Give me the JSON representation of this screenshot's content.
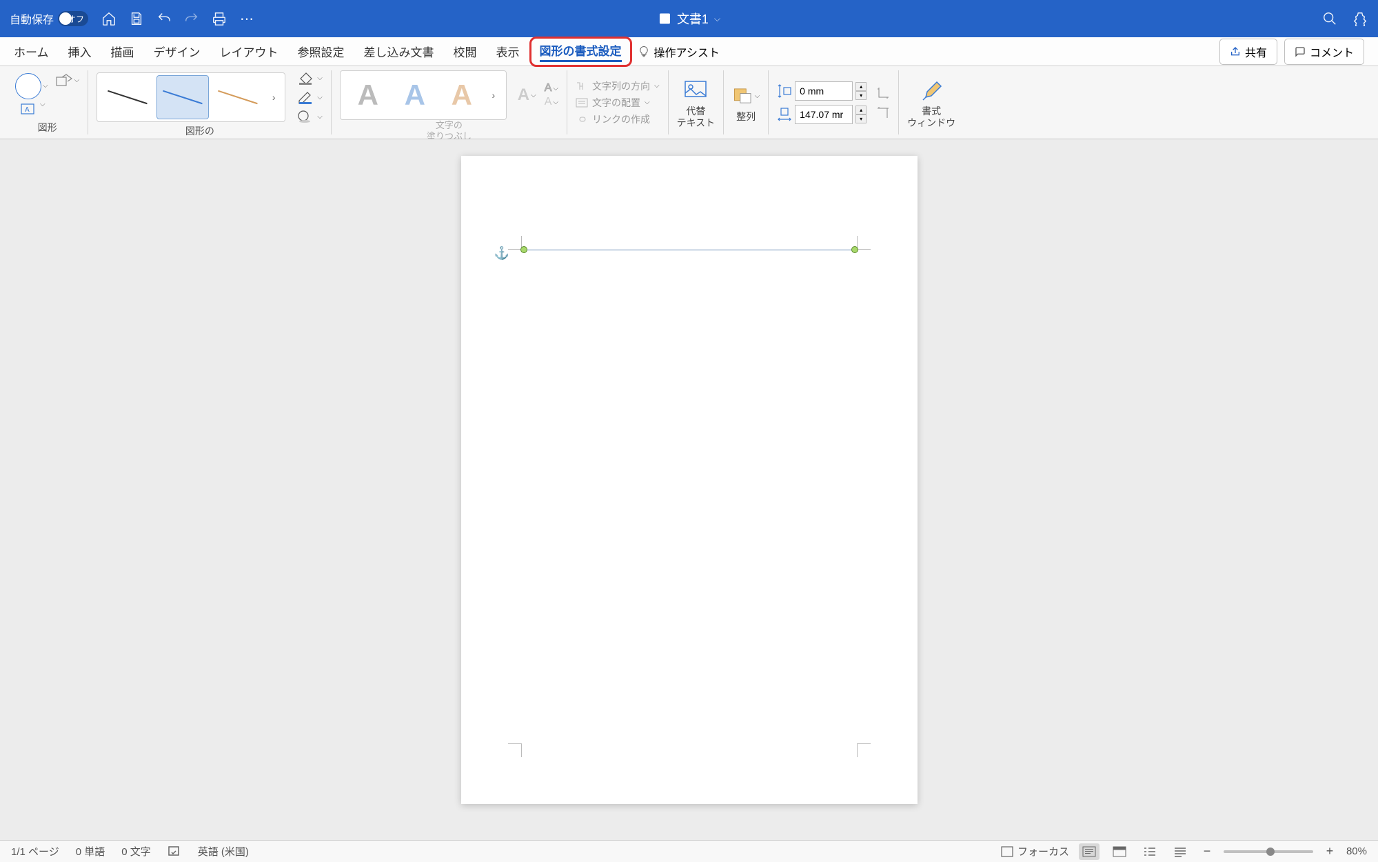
{
  "titlebar": {
    "autosave_label": "自動保存",
    "autosave_state": "オフ",
    "doc_title": "文書1"
  },
  "tabs": {
    "home": "ホーム",
    "insert": "挿入",
    "draw": "描画",
    "design": "デザイン",
    "layout": "レイアウト",
    "references": "参照設定",
    "mailings": "差し込み文書",
    "review": "校閲",
    "view": "表示",
    "shape_format": "図形の書式設定",
    "assist": "操作アシスト",
    "share": "共有",
    "comment": "コメント"
  },
  "ribbon": {
    "shapes_label": "図形",
    "shape_fill_label": "図形の\n塗りつぶし",
    "text_fill_label": "文字の\n塗りつぶし",
    "text_direction": "文字列の方向",
    "text_align": "文字の配置",
    "link_create": "リンクの作成",
    "alt_text_label": "代替\nテキスト",
    "arrange_label": "整列",
    "height_value": "0 mm",
    "width_value": "147.07 mr",
    "format_pane_label": "書式\nウィンドウ"
  },
  "statusbar": {
    "page": "1/1 ページ",
    "words": "0 単語",
    "chars": "0 文字",
    "language": "英語 (米国)",
    "focus": "フォーカス",
    "zoom": "80%"
  }
}
